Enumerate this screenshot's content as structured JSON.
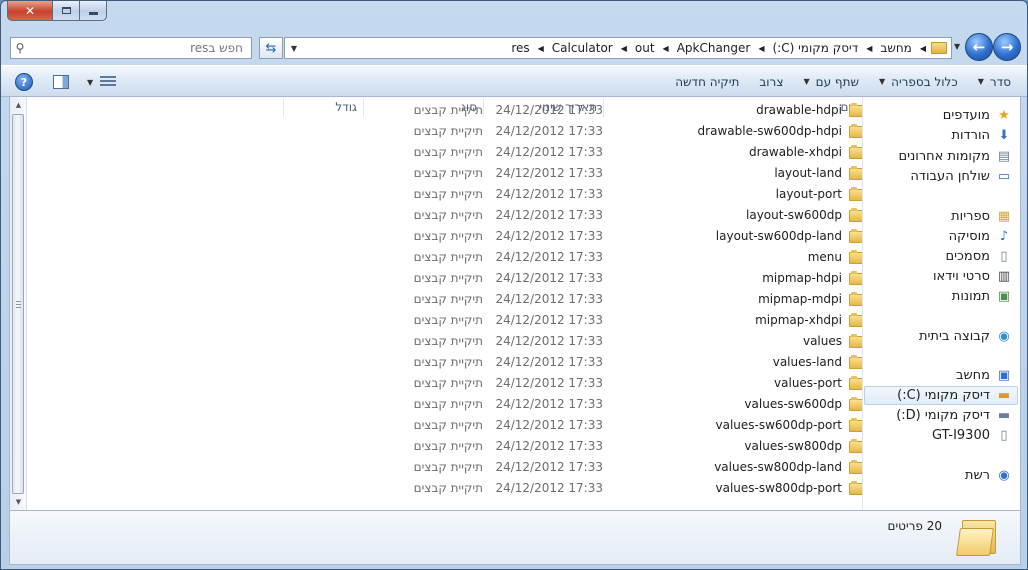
{
  "window": {
    "search_placeholder": "חפש בres",
    "breadcrumbs": [
      "מחשב",
      "דיסק מקומי (C:)",
      "ApkChanger",
      "out",
      "Calculator",
      "res"
    ]
  },
  "toolbar": {
    "items": [
      {
        "label": "סדר",
        "has_caret": true
      },
      {
        "label": "כלול בספריה",
        "has_caret": true
      },
      {
        "label": "שתף עם",
        "has_caret": true
      },
      {
        "label": "צרוב",
        "has_caret": false
      },
      {
        "label": "תיקיה חדשה",
        "has_caret": false
      }
    ],
    "help_symbol": "?"
  },
  "nav": {
    "favorites": [
      {
        "label": "מועדפים",
        "icon": "star-icon",
        "glyph": "★",
        "color": "#e8a21b"
      },
      {
        "label": "הורדות",
        "icon": "downloads-icon",
        "glyph": "⬇",
        "color": "#3b73c2"
      },
      {
        "label": "מקומות אחרונים",
        "icon": "recent-places-icon",
        "glyph": "▤",
        "color": "#6b7f98"
      },
      {
        "label": "שולחן העבודה",
        "icon": "desktop-icon",
        "glyph": "▭",
        "color": "#2f6fcf"
      }
    ],
    "libraries": [
      {
        "label": "ספריות",
        "icon": "libraries-icon",
        "glyph": "▦",
        "color": "#d8a73a"
      },
      {
        "label": "מוסיקה",
        "icon": "music-icon",
        "glyph": "♪",
        "color": "#2f6fcf"
      },
      {
        "label": "מסמכים",
        "icon": "documents-icon",
        "glyph": "▯",
        "color": "#6b7f98"
      },
      {
        "label": "סרטי וידאו",
        "icon": "videos-icon",
        "glyph": "▥",
        "color": "#444"
      },
      {
        "label": "תמונות",
        "icon": "pictures-icon",
        "glyph": "▣",
        "color": "#4a8f4a"
      }
    ],
    "homegroup": {
      "label": "קבוצה ביתית",
      "icon": "homegroup-icon",
      "glyph": "◉",
      "color": "#2f8fcf"
    },
    "computer": [
      {
        "label": "מחשב",
        "icon": "computer-icon",
        "glyph": "▣",
        "color": "#2f6fcf",
        "selected": false
      },
      {
        "label": "דיסק מקומי (C:)",
        "icon": "drive-c-icon",
        "glyph": "▬",
        "color": "#d89b2a",
        "selected": true
      },
      {
        "label": "דיסק מקומי (D:)",
        "icon": "drive-d-icon",
        "glyph": "▬",
        "color": "#6b7f98",
        "selected": false
      },
      {
        "label": "GT-I9300",
        "icon": "phone-icon",
        "glyph": "▯",
        "color": "#6b7f98",
        "selected": false
      }
    ],
    "network": {
      "label": "רשת",
      "icon": "network-icon",
      "glyph": "◉",
      "color": "#2f6fcf"
    }
  },
  "columns": {
    "name": "שם",
    "date": "תאריך שינוי",
    "type": "סוג",
    "size": "גודל"
  },
  "files": [
    {
      "name": "drawable-hdpi",
      "date": "24/12/2012 17:33",
      "type": "תיקיית קבצים"
    },
    {
      "name": "drawable-sw600dp-hdpi",
      "date": "24/12/2012 17:33",
      "type": "תיקיית קבצים"
    },
    {
      "name": "drawable-xhdpi",
      "date": "24/12/2012 17:33",
      "type": "תיקיית קבצים"
    },
    {
      "name": "layout-land",
      "date": "24/12/2012 17:33",
      "type": "תיקיית קבצים"
    },
    {
      "name": "layout-port",
      "date": "24/12/2012 17:33",
      "type": "תיקיית קבצים"
    },
    {
      "name": "layout-sw600dp",
      "date": "24/12/2012 17:33",
      "type": "תיקיית קבצים"
    },
    {
      "name": "layout-sw600dp-land",
      "date": "24/12/2012 17:33",
      "type": "תיקיית קבצים"
    },
    {
      "name": "menu",
      "date": "24/12/2012 17:33",
      "type": "תיקיית קבצים"
    },
    {
      "name": "mipmap-hdpi",
      "date": "24/12/2012 17:33",
      "type": "תיקיית קבצים"
    },
    {
      "name": "mipmap-mdpi",
      "date": "24/12/2012 17:33",
      "type": "תיקיית קבצים"
    },
    {
      "name": "mipmap-xhdpi",
      "date": "24/12/2012 17:33",
      "type": "תיקיית קבצים"
    },
    {
      "name": "values",
      "date": "24/12/2012 17:33",
      "type": "תיקיית קבצים"
    },
    {
      "name": "values-land",
      "date": "24/12/2012 17:33",
      "type": "תיקיית קבצים"
    },
    {
      "name": "values-port",
      "date": "24/12/2012 17:33",
      "type": "תיקיית קבצים"
    },
    {
      "name": "values-sw600dp",
      "date": "24/12/2012 17:33",
      "type": "תיקיית קבצים"
    },
    {
      "name": "values-sw600dp-port",
      "date": "24/12/2012 17:33",
      "type": "תיקיית קבצים"
    },
    {
      "name": "values-sw800dp",
      "date": "24/12/2012 17:33",
      "type": "תיקיית קבצים"
    },
    {
      "name": "values-sw800dp-land",
      "date": "24/12/2012 17:33",
      "type": "תיקיית קבצים"
    },
    {
      "name": "values-sw800dp-port",
      "date": "24/12/2012 17:33",
      "type": "תיקיית קבצים"
    }
  ],
  "details": {
    "item_count": "20 פריטים"
  }
}
